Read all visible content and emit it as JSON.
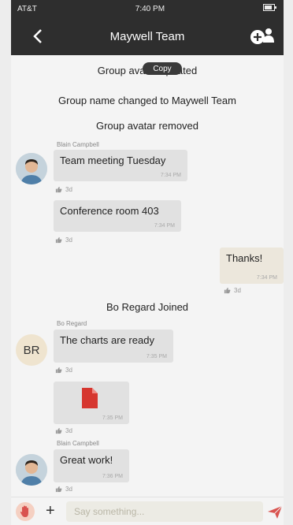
{
  "status_bar": {
    "carrier": "AT&T",
    "time": "7:40 PM"
  },
  "header": {
    "title": "Maywell Team"
  },
  "tooltip": "Copy",
  "system_messages": {
    "avatar_updated": "Group avatar updated",
    "name_changed": "Group name changed to  Maywell Team",
    "avatar_removed": "Group avatar removed",
    "joined": "Bo Regard Joined"
  },
  "messages": [
    {
      "sender": "Blain Campbell",
      "text": "Team meeting Tuesday",
      "time": "7:34 PM",
      "meta": "3d"
    },
    {
      "sender": "",
      "text": "Conference room 403",
      "time": "7:34 PM",
      "meta": "3d"
    },
    {
      "sender": "",
      "text": "Thanks!",
      "time": "7:34 PM",
      "meta": "3d"
    },
    {
      "sender": "Bo Regard",
      "text": "The charts are ready",
      "time": "7:35 PM",
      "meta": "3d",
      "initials": "BR"
    },
    {
      "sender": "",
      "text": "",
      "time": "7:35 PM",
      "meta": "3d"
    },
    {
      "sender": "Blain Campbell",
      "text": "Great work!",
      "time": "7:36 PM",
      "meta": "3d"
    }
  ],
  "composer": {
    "placeholder": "Say something..."
  },
  "colors": {
    "header_bg": "#2e2e2e",
    "accent_red": "#d9534f",
    "bubble_in": "#e1e1e1",
    "bubble_out": "#ece7dc"
  },
  "icons": [
    "back-icon",
    "group-add-icon",
    "thumb-icon",
    "document-icon",
    "hand-icon",
    "plus-icon",
    "send-icon"
  ]
}
